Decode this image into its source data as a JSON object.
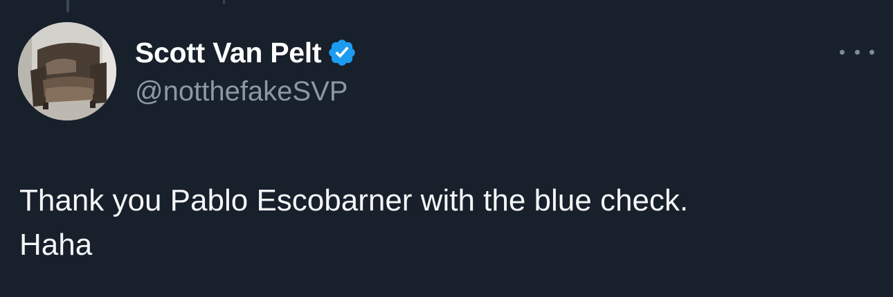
{
  "author": {
    "display_name": "Scott Van Pelt",
    "handle": "@notthefakeSVP",
    "verified": true,
    "avatar_icon": "avatar-armchair-photo"
  },
  "tweet": {
    "text_line_1": "Thank you Pablo Escobarner with the blue check.",
    "text_line_2": "Haha"
  },
  "menu": {
    "icon": "more-options-icon"
  },
  "colors": {
    "background": "#17202b",
    "verified_badge": "#1d9bf0",
    "handle": "#8b98a5",
    "text": "#f5f6f7"
  }
}
